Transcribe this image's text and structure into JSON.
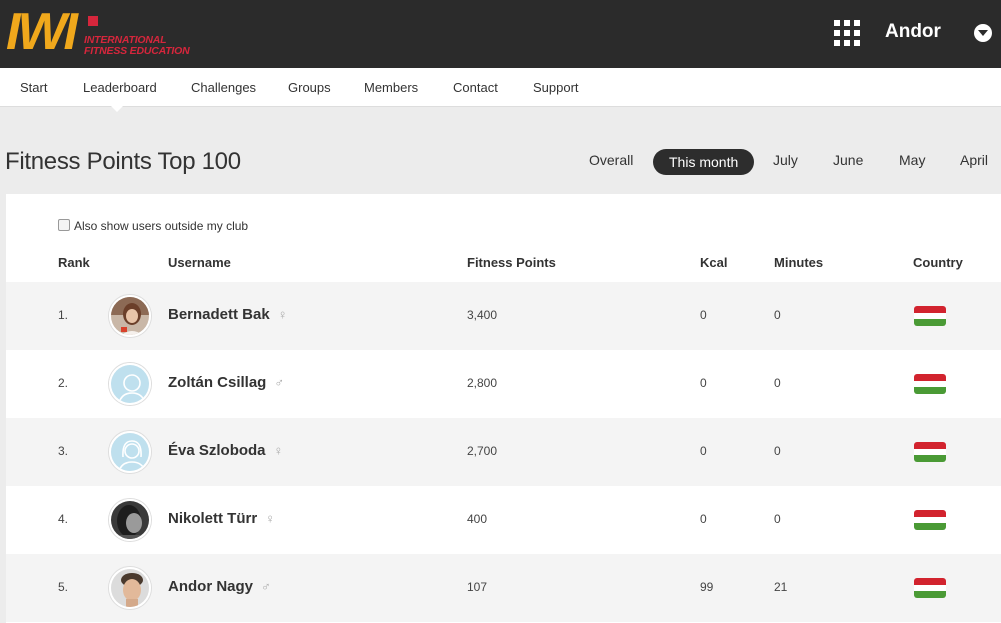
{
  "brand": {
    "logo_mark": "IWI",
    "tagline": "International Fitness Education",
    "colors": {
      "orange": "#f0a81c",
      "red": "#d6263c",
      "topbar": "#2b2b2b"
    }
  },
  "header": {
    "apps_icon": "grid-icon",
    "user_name": "Andor",
    "user_menu_icon": "chevron-down-icon"
  },
  "nav": {
    "items": [
      "Start",
      "Leaderboard",
      "Challenges",
      "Groups",
      "Members",
      "Contact",
      "Support"
    ],
    "active": "Leaderboard"
  },
  "page": {
    "title": "Fitness Points Top 100",
    "filters": [
      "Overall",
      "This month",
      "July",
      "June",
      "May",
      "April"
    ],
    "active_filter": "This month"
  },
  "options": {
    "show_outside_club_label": "Also show users outside my club",
    "show_outside_club_checked": false
  },
  "table": {
    "headers": {
      "rank": "Rank",
      "username": "Username",
      "points": "Fitness Points",
      "kcal": "Kcal",
      "minutes": "Minutes",
      "country": "Country"
    },
    "rows": [
      {
        "rank": "1.",
        "name": "Bernadett Bak",
        "gender": "♀",
        "points": "3,400",
        "kcal": "0",
        "minutes": "0",
        "avatar": "photo",
        "flag": "hungary-flag"
      },
      {
        "rank": "2.",
        "name": "Zoltán Csillag",
        "gender": "♂",
        "points": "2,800",
        "kcal": "0",
        "minutes": "0",
        "avatar": "default-male",
        "flag": "hungary-flag"
      },
      {
        "rank": "3.",
        "name": "Éva Szloboda",
        "gender": "♀",
        "points": "2,700",
        "kcal": "0",
        "minutes": "0",
        "avatar": "default-female",
        "flag": "hungary-flag"
      },
      {
        "rank": "4.",
        "name": "Nikolett Türr",
        "gender": "♀",
        "points": "400",
        "kcal": "0",
        "minutes": "0",
        "avatar": "photo",
        "flag": "hungary-flag"
      },
      {
        "rank": "5.",
        "name": "Andor Nagy",
        "gender": "♂",
        "points": "107",
        "kcal": "99",
        "minutes": "21",
        "avatar": "photo",
        "flag": "hungary-flag"
      }
    ]
  },
  "flag_colors": [
    "#d2232e",
    "#ffffff",
    "#4a9a35"
  ]
}
